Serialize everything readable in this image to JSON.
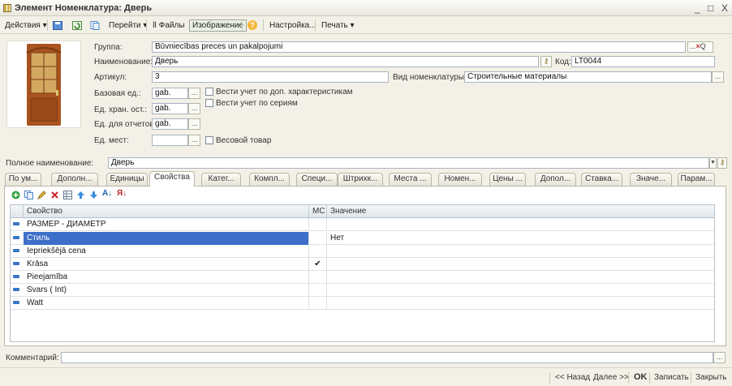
{
  "window": {
    "title": "Элемент Номенклатура: Дверь",
    "controls": [
      "_",
      "□",
      "X"
    ]
  },
  "toolbar": {
    "actions": "Действия",
    "goto": "Перейти",
    "files": "Файлы",
    "image": "Изображение",
    "help": "?",
    "settings": "Настройка...",
    "print": "Печать"
  },
  "form": {
    "group_label": "Группа:",
    "group_value": "Būvniecības preces un pakalpojumi",
    "name_label": "Наименование:",
    "name_value": "Дверь",
    "code_label": "Код:",
    "code_value": "LT0044",
    "article_label": "Артикул:",
    "article_value": "3",
    "kind_label": "Вид номенклатуры:",
    "kind_value": "Строительные материалы",
    "base_unit_label": "Базовая ед.:",
    "base_unit_value": "gab.",
    "store_unit_label": "Ед. хран. ост.:",
    "store_unit_value": "gab.",
    "report_unit_label": "Ед. для отчетов:",
    "report_unit_value": "gab.",
    "places_label": "Ед. мест:",
    "places_value": "",
    "chk_extra": "Вести учет по доп. характеристикам",
    "chk_series": "Вести учет по сериям",
    "chk_weight": "Весовой товар",
    "fullname_label": "Полное наименование:",
    "fullname_value": "Дверь",
    "comment_label": "Комментарий:",
    "comment_value": "",
    "dots": "...",
    "clear": "×",
    "search": "Q",
    "dropdown": "▼"
  },
  "tabs": [
    "По ум...",
    "Дополн...",
    "Единицы",
    "Свойства",
    "Катег...",
    "Компл...",
    "Специ...",
    "Штрихк...",
    "Места ...",
    "Номен...",
    "Цены ...",
    "Допол...",
    "Ставка...",
    "Значе...",
    "Парам..."
  ],
  "active_tab": 3,
  "grid": {
    "headers": {
      "property": "Свойство",
      "ms": "МС",
      "value": "Значение"
    },
    "rows": [
      {
        "property": "РАЗМЕР - ДИАМЕТР",
        "ms": "",
        "value": ""
      },
      {
        "property": "Стиль",
        "ms": "",
        "value": "Нет"
      },
      {
        "property": "Iepriekšējā cena",
        "ms": "",
        "value": ""
      },
      {
        "property": "Krāsa",
        "ms": "✔",
        "value": ""
      },
      {
        "property": "Pieejamība",
        "ms": "",
        "value": ""
      },
      {
        "property": "Svars ( Int)",
        "ms": "",
        "value": ""
      },
      {
        "property": "Watt",
        "ms": "",
        "value": ""
      }
    ]
  },
  "status": {
    "prev": "<< Назад",
    "next": "Далее >>",
    "ok": "OK",
    "save": "Записать",
    "close": "Закрыть"
  },
  "colors": {
    "accent": "#3d6fc9",
    "toolbar_bg": "#f3f1e7",
    "grid_header": "#dfe6ea"
  }
}
